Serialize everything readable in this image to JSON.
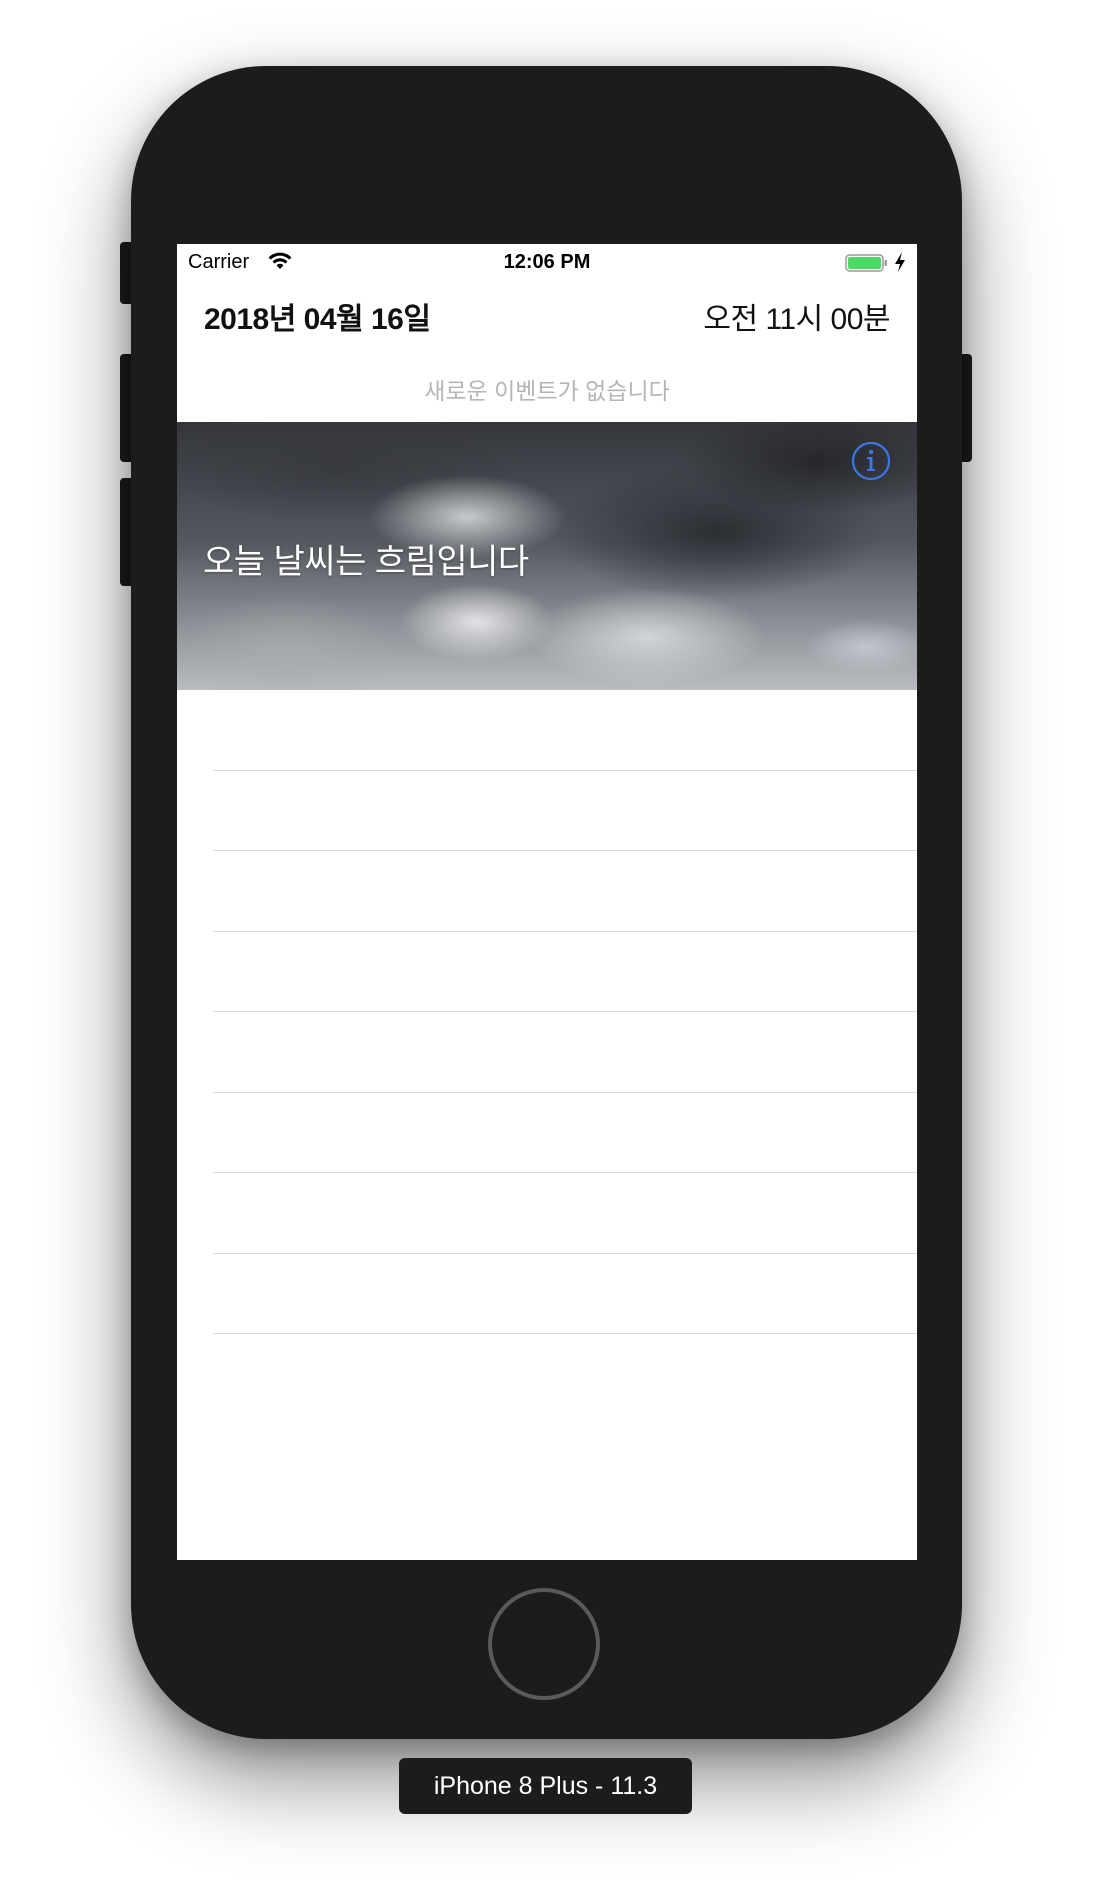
{
  "status_bar": {
    "carrier": "Carrier",
    "time": "12:06 PM",
    "battery_color": "#4cd964"
  },
  "header": {
    "date": "2018년 04월 16일",
    "time": "오전 11시 00분"
  },
  "events": {
    "empty_message": "새로운 이벤트가 없습니다"
  },
  "weather": {
    "message": "오늘 날씨는 흐림입니다",
    "info_icon": "info-icon",
    "accent_color": "#3b78e7"
  },
  "table": {
    "rows": [
      "",
      "",
      "",
      "",
      "",
      "",
      "",
      "",
      ""
    ]
  },
  "simulator": {
    "device_label": "iPhone 8 Plus - 11.3"
  }
}
